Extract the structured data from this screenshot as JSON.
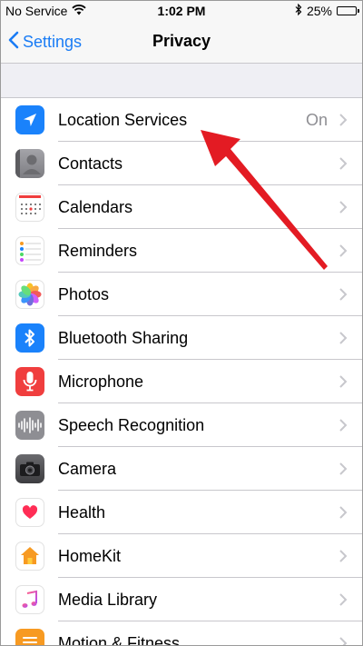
{
  "status_bar": {
    "carrier": "No Service",
    "time": "1:02 PM",
    "battery": "25%",
    "battery_level": 0.25
  },
  "nav": {
    "back_label": "Settings",
    "title": "Privacy"
  },
  "rows": [
    {
      "label": "Location Services",
      "value": "On",
      "icon": "location-arrow-icon",
      "color": "#1a82fb"
    },
    {
      "label": "Contacts",
      "value": "",
      "icon": "contacts-icon",
      "color": "#8e8e93"
    },
    {
      "label": "Calendars",
      "value": "",
      "icon": "calendar-icon",
      "color": "#ffffff"
    },
    {
      "label": "Reminders",
      "value": "",
      "icon": "reminders-icon",
      "color": "#ffffff"
    },
    {
      "label": "Photos",
      "value": "",
      "icon": "photos-icon",
      "color": "#ffffff"
    },
    {
      "label": "Bluetooth Sharing",
      "value": "",
      "icon": "bluetooth-icon",
      "color": "#1a82fb"
    },
    {
      "label": "Microphone",
      "value": "",
      "icon": "microphone-icon",
      "color": "#f03e3e"
    },
    {
      "label": "Speech Recognition",
      "value": "",
      "icon": "speech-waveform-icon",
      "color": "#8e8e93"
    },
    {
      "label": "Camera",
      "value": "",
      "icon": "camera-icon",
      "color": "#5a5a5a"
    },
    {
      "label": "Health",
      "value": "",
      "icon": "heart-icon",
      "color": "#ffffff"
    },
    {
      "label": "HomeKit",
      "value": "",
      "icon": "home-icon",
      "color": "#ffffff"
    },
    {
      "label": "Media Library",
      "value": "",
      "icon": "music-note-icon",
      "color": "#ffffff"
    },
    {
      "label": "Motion & Fitness",
      "value": "",
      "icon": "motion-icon",
      "color": "#f79a22"
    }
  ],
  "colors": {
    "accent": "#1a7cf5",
    "annotation_arrow": "#e31b23"
  }
}
